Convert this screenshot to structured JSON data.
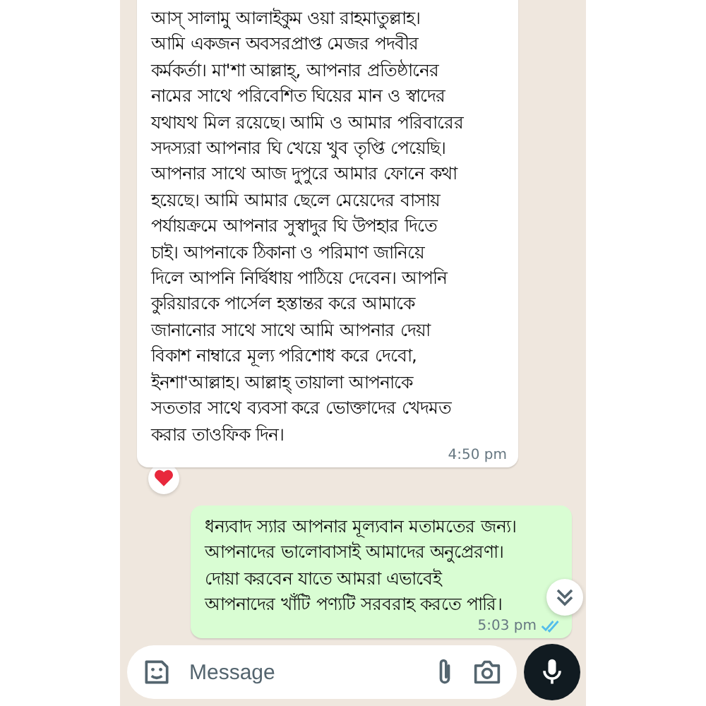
{
  "messages": [
    {
      "kind": "incoming",
      "lines": [
        "আস্ সালামু আলাইকুম ওয়া রাহমাতুল্লাহ।",
        "আমি একজন অবসরপ্রাপ্ত মেজর পদবীর",
        "কর্মকর্তা। মা'শা আল্লাহ্, আপনার প্রতিষ্ঠানের",
        "নামের সাথে পরিবেশিত ঘিয়ের মান ও স্বাদের",
        "যথাযথ মিল রয়েছে। আমি ও আমার পরিবারের",
        "সদস্যরা আপনার ঘি খেয়ে খুব তৃপ্তি পেয়েছি।",
        "আপনার সাথে আজ দুপুরে আমার ফোনে কথা",
        "হয়েছে। আমি আমার ছেলে মেয়েদের বাসায়",
        "পর্যায়ক্রমে আপনার সুস্বাদুর ঘি উপহার দিতে",
        "চাই। আপনাকে ঠিকানা ও পরিমাণ জানিয়ে",
        "দিলে আপনি নির্দ্বিধায় পাঠিয়ে দেবেন। আপনি",
        "কুরিয়ারকে পার্সেল হস্তান্তর করে আমাকে",
        "জানানোর সাথে সাথে আমি আপনার দেয়া",
        "বিকাশ নাম্বারে মূল্য পরিশোধ করে দেবো,",
        "ইনশা'আল্লাহ। আল্লাহ্ তায়ালা আপনাকে",
        "সততার সাথে ব্যবসা করে ভোক্তাদের খেদমত",
        "করার তাওফিক দিন।"
      ],
      "time": "4:50 pm",
      "reaction": true
    },
    {
      "kind": "outgoing",
      "lines": [
        "ধন্যবাদ স্যার আপনার মূল্যবান মতামতের জন্য।",
        "আপনাদের ভালোবাসাই আমাদের অনুপ্রেরণা।",
        "দোয়া করবেন যাতে  আমরা এভাবেই",
        "আপনাদের খাঁটি পণ্যটি সরবরাহ করতে পারি।"
      ],
      "time": "5:03 pm",
      "reaction": false,
      "read": true
    }
  ],
  "composer": {
    "placeholder": "Message"
  }
}
